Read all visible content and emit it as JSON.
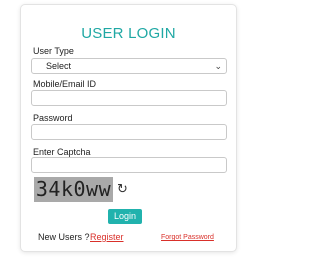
{
  "login": {
    "title": "USER LOGIN",
    "user_type_label": "User Type",
    "user_type_selected": "Select",
    "mobile_label": "Mobile/Email ID",
    "mobile_value": "",
    "password_label": "Password",
    "password_value": "",
    "captcha_label": "Enter Captcha",
    "captcha_value": "",
    "captcha_text": "34k0ww",
    "refresh_icon": "↻",
    "login_button": "Login",
    "new_users_text": "New Users ?",
    "register_link": "Register",
    "forgot_link": "Forgot Password"
  },
  "colors": {
    "accent": "#21b2ad",
    "title": "#1fa8a4",
    "link": "#d9302a",
    "captcha_bg": "#a9a9a9"
  }
}
